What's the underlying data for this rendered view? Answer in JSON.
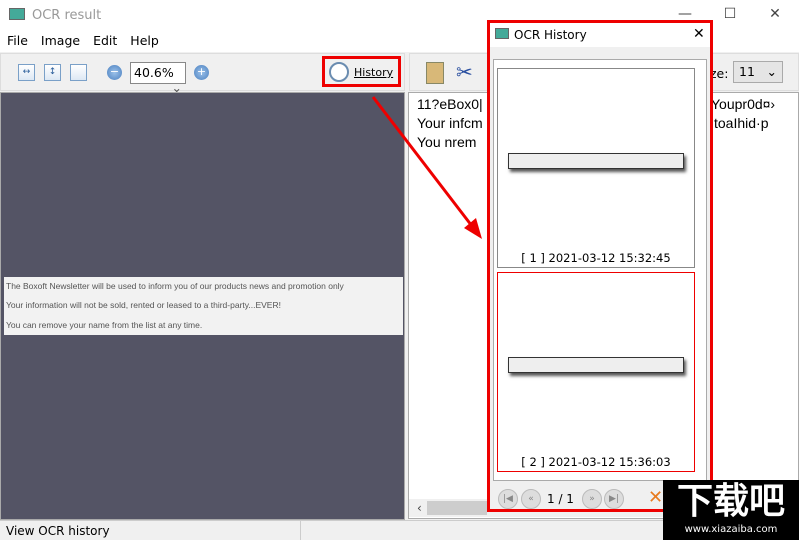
{
  "window": {
    "title": "OCR result",
    "minimize": "—",
    "maximize": "☐",
    "close": "✕"
  },
  "menu": [
    "File",
    "Image",
    "Edit",
    "Help"
  ],
  "toolbar": {
    "zoom": "40.6%",
    "history_label": "History",
    "font_size_label": "ze:",
    "font_size": "11"
  },
  "image_text": [
    "The Boxoft Newsletter will be used to inform you of our products news and promotion only",
    "Your information will not be sold, rented or leased to a third-party...EVER!",
    "You can remove your name from the list at any time."
  ],
  "ocr_lines": [
    {
      "left": "11?eBox0|",
      "right": "Youpr0d¤›"
    },
    {
      "left": "Your  infcm",
      "right": "toaIhid·p"
    },
    {
      "left": "You  nrem",
      "right": ""
    }
  ],
  "status": "View OCR history",
  "dialog": {
    "title": "OCR History",
    "close": "✕",
    "items": [
      {
        "caption": "[ 1 ] 2021-03-12 15:32:45"
      },
      {
        "caption": "[ 2 ] 2021-03-12 15:36:03"
      }
    ],
    "page": "1 / 1"
  },
  "watermark": {
    "text": "下载吧",
    "url": "www.xiazaiba.com"
  },
  "colors": {
    "highlight": "#e00000",
    "pane": "#545465"
  }
}
